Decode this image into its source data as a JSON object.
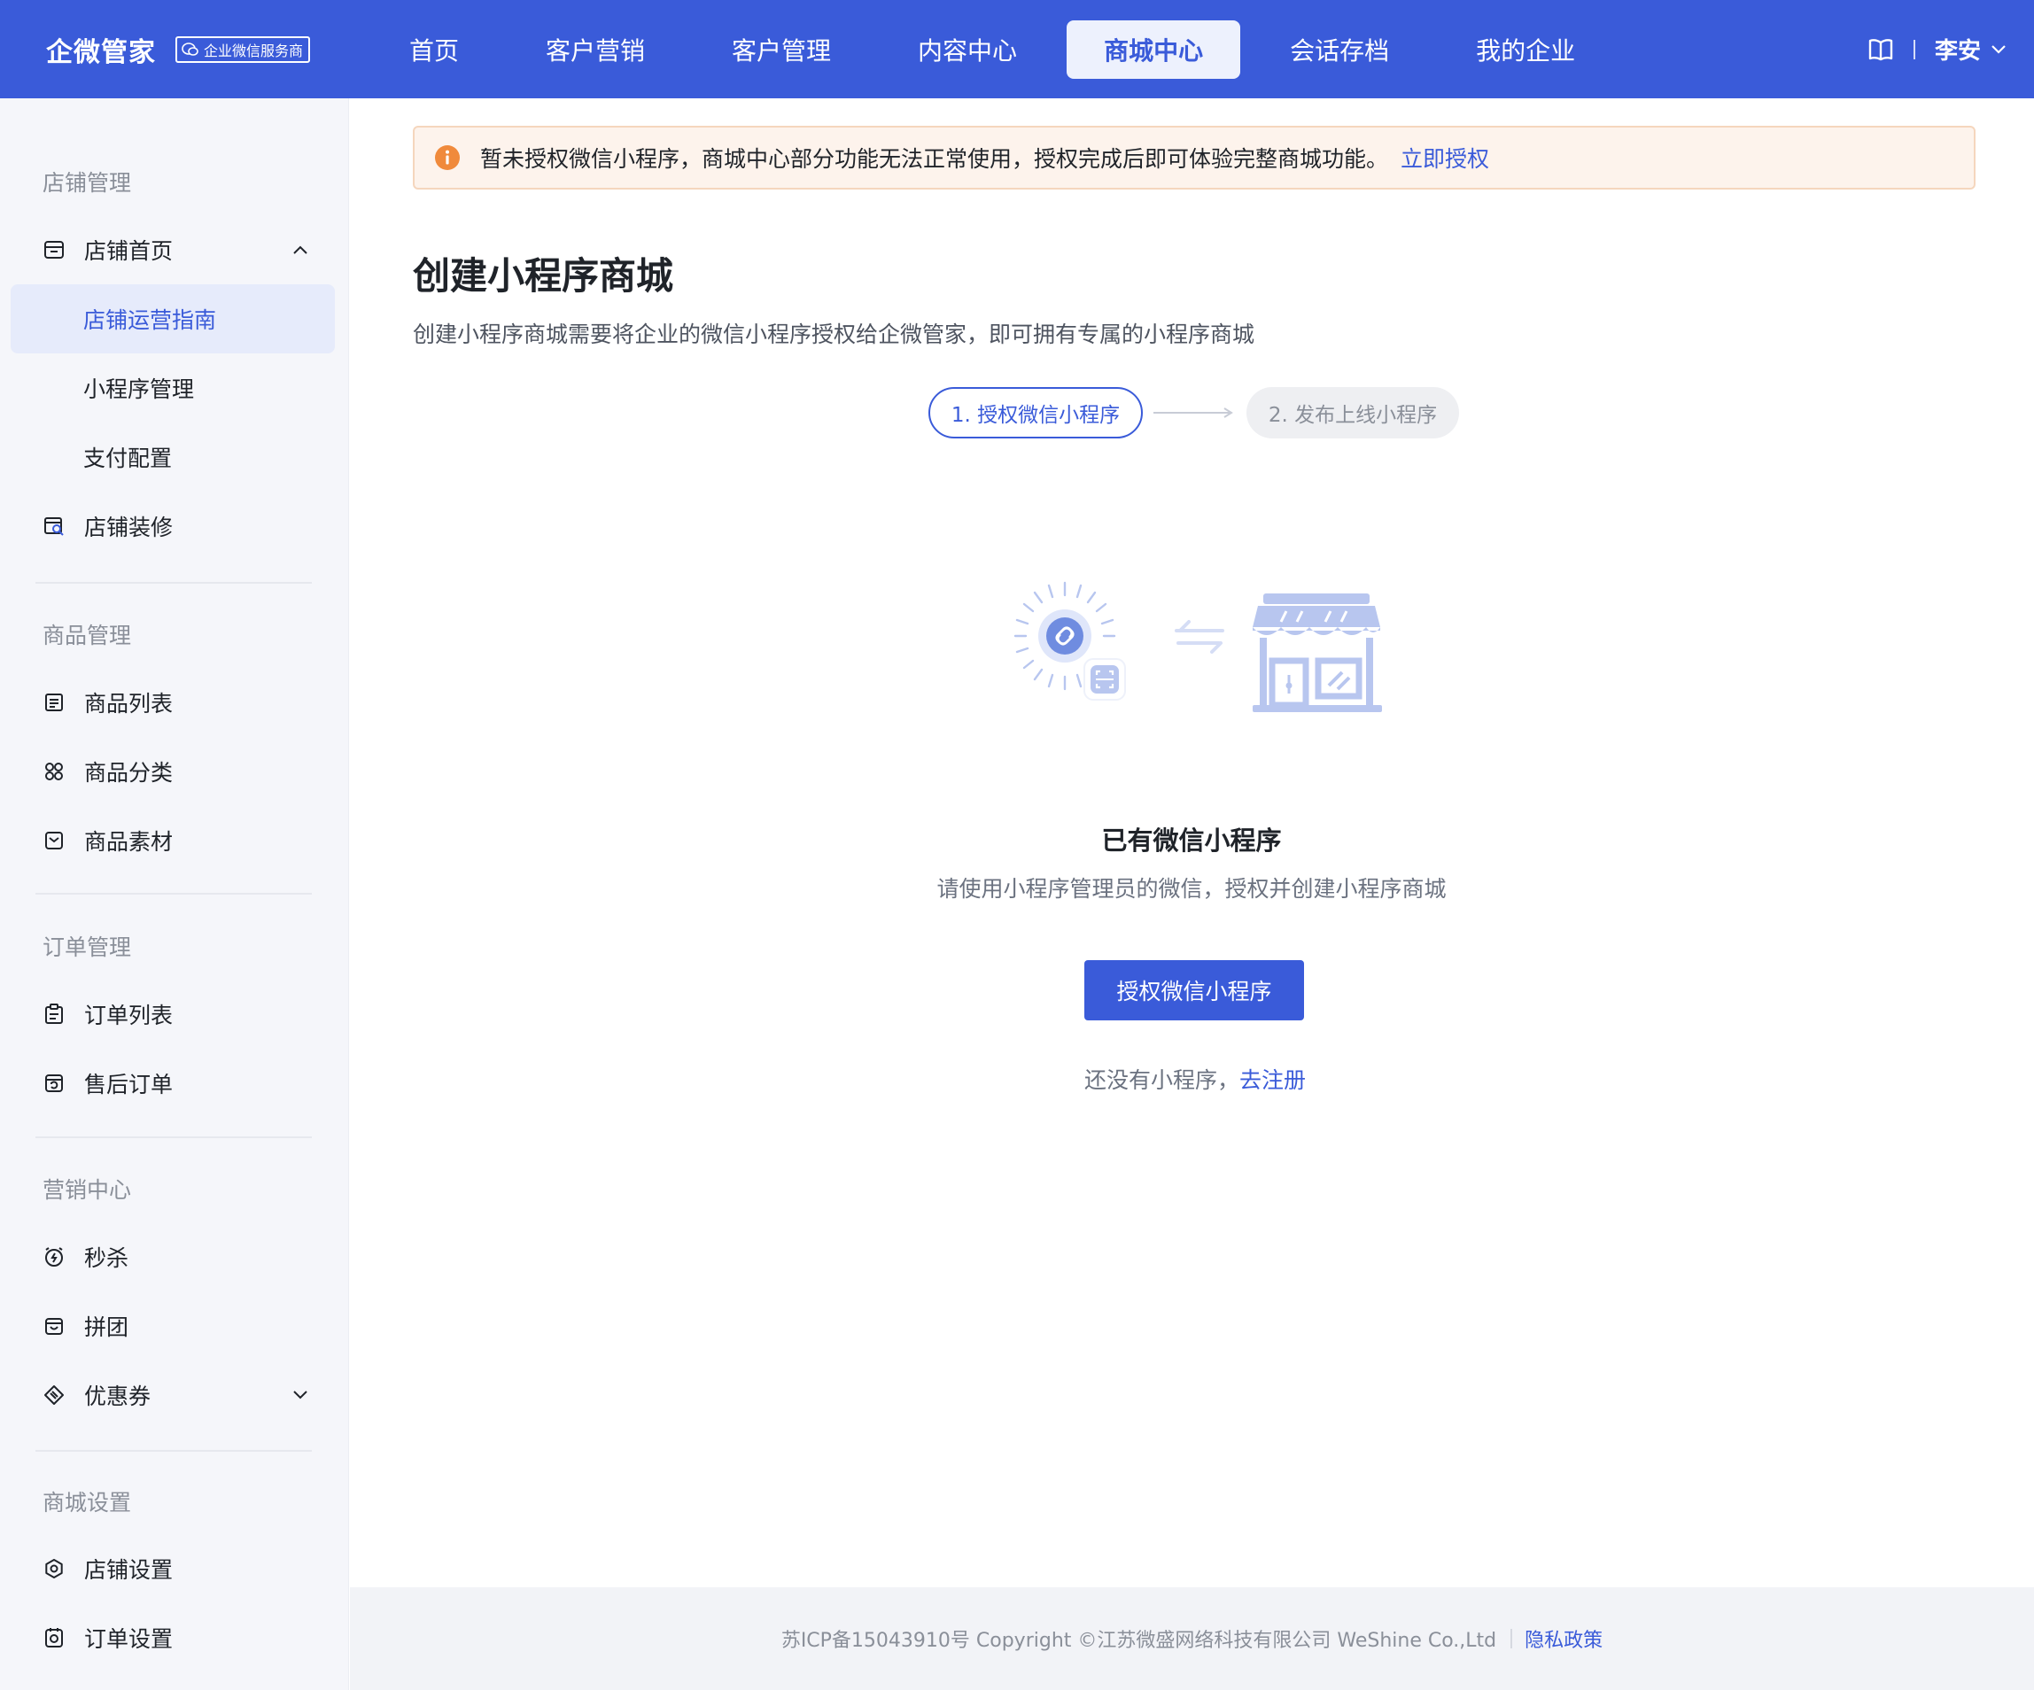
{
  "header": {
    "brand_name": "企微管家",
    "brand_badge": "企业微信服务商",
    "nav": [
      {
        "label": "首页"
      },
      {
        "label": "客户营销"
      },
      {
        "label": "客户管理"
      },
      {
        "label": "内容中心"
      },
      {
        "label": "商城中心",
        "active": true
      },
      {
        "label": "会话存档"
      },
      {
        "label": "我的企业"
      }
    ],
    "user_name": "李安"
  },
  "sidebar": {
    "sections": [
      {
        "title": "店铺管理"
      },
      {
        "title": "商品管理"
      },
      {
        "title": "订单管理"
      },
      {
        "title": "营销中心"
      },
      {
        "title": "商城设置"
      }
    ],
    "items": [
      {
        "label": "店铺首页",
        "icon": "shop-home-icon"
      },
      {
        "label": "店铺运营指南",
        "active": true
      },
      {
        "label": "小程序管理"
      },
      {
        "label": "支付配置"
      },
      {
        "label": "店铺装修",
        "icon": "shop-decor-icon"
      },
      {
        "label": "商品列表",
        "icon": "list-icon"
      },
      {
        "label": "商品分类",
        "icon": "category-icon"
      },
      {
        "label": "商品素材",
        "icon": "material-icon"
      },
      {
        "label": "订单列表",
        "icon": "order-list-icon"
      },
      {
        "label": "售后订单",
        "icon": "after-sale-icon"
      },
      {
        "label": "秒杀",
        "icon": "flash-sale-icon"
      },
      {
        "label": "拼团",
        "icon": "group-buy-icon"
      },
      {
        "label": "优惠券",
        "icon": "coupon-icon"
      },
      {
        "label": "店铺设置",
        "icon": "shop-settings-icon"
      },
      {
        "label": "订单设置",
        "icon": "order-settings-icon"
      }
    ]
  },
  "alert": {
    "text": "暂未授权微信小程序，商城中心部分功能无法正常使用，授权完成后即可体验完整商城功能。",
    "link": "立即授权"
  },
  "main": {
    "title": "创建小程序商城",
    "description": "创建小程序商城需要将企业的微信小程序授权给企微管家，即可拥有专属的小程序商城",
    "steps": [
      {
        "label": "1. 授权微信小程序",
        "active": true
      },
      {
        "label": "2. 发布上线小程序"
      }
    ],
    "empty_title": "已有微信小程序",
    "empty_sub": "请使用小程序管理员的微信，授权并创建小程序商城",
    "auth_button": "授权微信小程序",
    "register_prefix": "还没有小程序，",
    "register_link": "去注册"
  },
  "footer": {
    "copyright": "苏ICP备15043910号 Copyright ©江苏微盛网络科技有限公司 WeShine Co.,Ltd",
    "privacy": "隐私政策"
  },
  "colors": {
    "primary": "#3a5bd9",
    "alert_bg": "#fdf3ec",
    "alert_icon": "#f08a3c",
    "illustration": "#b8c6ef"
  }
}
